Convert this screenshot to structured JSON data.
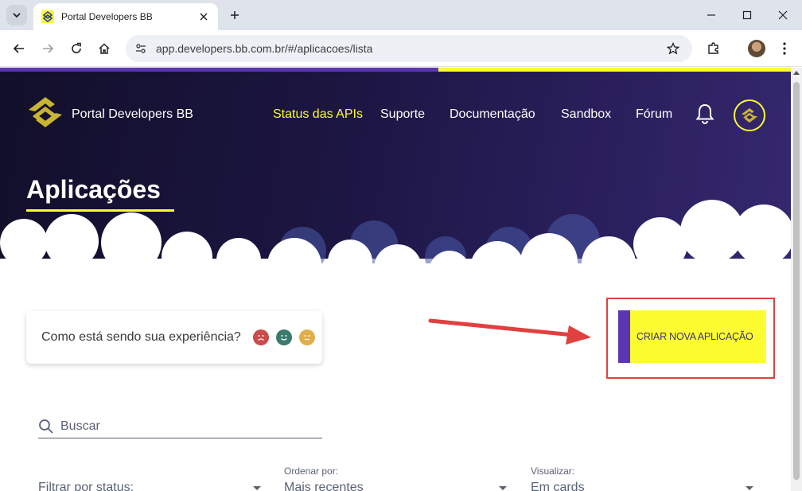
{
  "browser": {
    "tab_title": "Portal Developers BB",
    "url": "app.developers.bb.com.br/#/aplicacoes/lista"
  },
  "colors": {
    "hero_dark": "#120f2a",
    "hero_purple": "#35286f",
    "brand_yellow": "#fcfc30",
    "brand_purple": "#5b36b3",
    "highlight_red": "#e0413f"
  },
  "header": {
    "logo_text": "Portal Developers BB",
    "nav": [
      {
        "label": "Status das APIs",
        "active": true
      },
      {
        "label": "Suporte"
      },
      {
        "label": "Documentação"
      },
      {
        "label": "Sandbox"
      },
      {
        "label": "Fórum"
      }
    ],
    "icons": [
      "bell-icon",
      "bb-logo-icon"
    ]
  },
  "hero": {
    "title": "Aplicações"
  },
  "feedback": {
    "question": "Como está sendo sua experiência?",
    "faces": [
      "sad-face-icon",
      "happy-face-icon",
      "neutral-face-icon"
    ]
  },
  "actions": {
    "create_label": "CRIAR NOVA APLICAÇÃO"
  },
  "search": {
    "placeholder": "Buscar"
  },
  "filters": [
    {
      "label": "",
      "value": "Filtrar por status:"
    },
    {
      "label": "Ordenar por:",
      "value": "Mais recentes"
    },
    {
      "label": "Visualizar:",
      "value": "Em cards"
    }
  ]
}
